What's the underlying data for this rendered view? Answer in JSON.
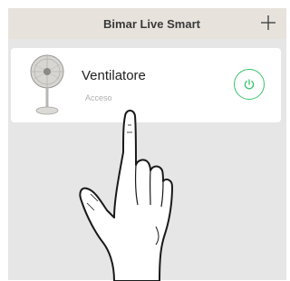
{
  "header": {
    "title": "Bimar Live Smart",
    "add_icon": "plus-icon"
  },
  "device": {
    "name": "Ventilatore",
    "status": "Acceso",
    "image": "fan-image",
    "power_icon": "power-icon",
    "power_color": "#37c36b"
  },
  "overlay": {
    "icon": "pointing-hand-icon"
  },
  "colors": {
    "header_bg": "#e7e3dc",
    "app_bg": "#e6e6e6",
    "card_bg": "#ffffff",
    "accent": "#37c36b"
  }
}
